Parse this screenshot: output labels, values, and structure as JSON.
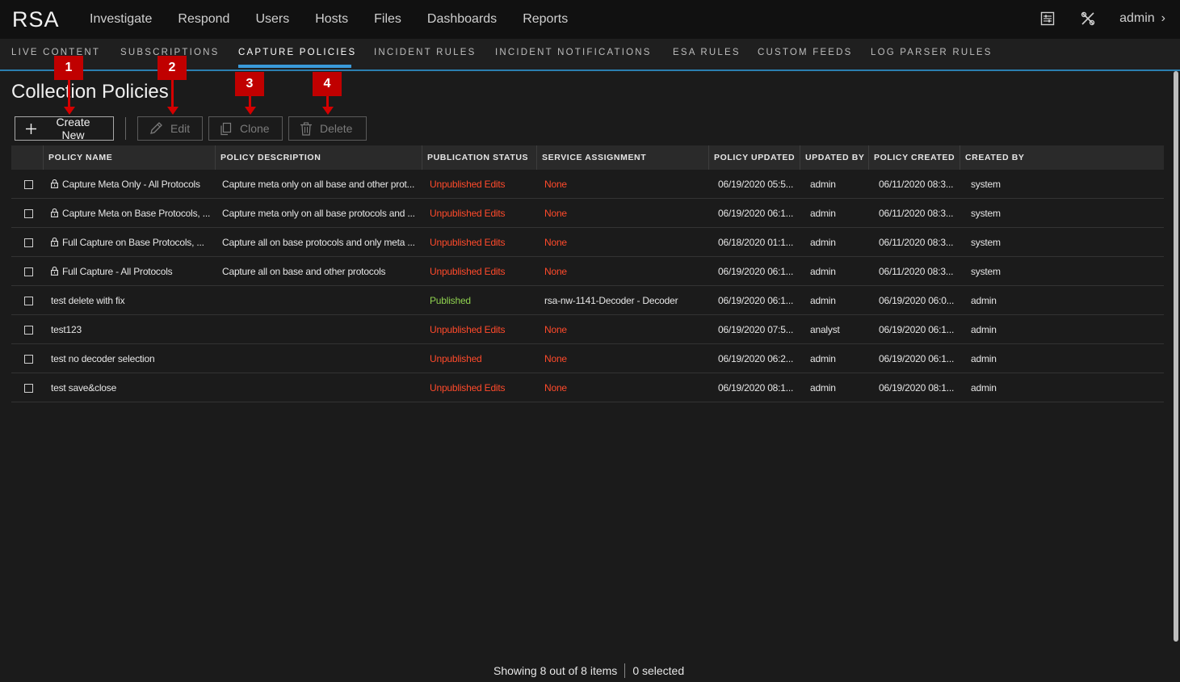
{
  "app": {
    "logo": "RSA"
  },
  "main_nav": [
    "Investigate",
    "Respond",
    "Users",
    "Hosts",
    "Files",
    "Dashboards",
    "Reports"
  ],
  "top_right": {
    "user": "admin"
  },
  "sub_tabs": [
    "LIVE CONTENT",
    "SUBSCRIPTIONS",
    "CAPTURE POLICIES",
    "INCIDENT RULES",
    "INCIDENT NOTIFICATIONS",
    "ESA RULES",
    "CUSTOM FEEDS",
    "LOG PARSER RULES"
  ],
  "active_sub_tab": "CAPTURE POLICIES",
  "page_title": "Collection Policies",
  "toolbar": {
    "create": "Create New",
    "edit": "Edit",
    "clone": "Clone",
    "delete": "Delete"
  },
  "annotations": [
    "1",
    "2",
    "3",
    "4"
  ],
  "columns": [
    "POLICY NAME",
    "POLICY DESCRIPTION",
    "PUBLICATION STATUS",
    "SERVICE ASSIGNMENT",
    "POLICY UPDATED",
    "UPDATED BY",
    "POLICY CREATED",
    "CREATED BY"
  ],
  "rows": [
    {
      "locked": true,
      "name": "Capture Meta Only - All Protocols",
      "description": "Capture meta only on all base and other prot...",
      "status": "Unpublished Edits",
      "service": "None",
      "updated": "06/19/2020 05:5...",
      "updated_by": "admin",
      "created": "06/11/2020 08:3...",
      "created_by": "system"
    },
    {
      "locked": true,
      "name": "Capture Meta on Base Protocols, ...",
      "description": "Capture meta only on all base protocols and ...",
      "status": "Unpublished Edits",
      "service": "None",
      "updated": "06/19/2020 06:1...",
      "updated_by": "admin",
      "created": "06/11/2020 08:3...",
      "created_by": "system"
    },
    {
      "locked": true,
      "name": "Full Capture on Base Protocols, ...",
      "description": "Capture all on base protocols and only meta ...",
      "status": "Unpublished Edits",
      "service": "None",
      "updated": "06/18/2020 01:1...",
      "updated_by": "admin",
      "created": "06/11/2020 08:3...",
      "created_by": "system"
    },
    {
      "locked": true,
      "name": "Full Capture - All Protocols",
      "description": "Capture all on base and other protocols",
      "status": "Unpublished Edits",
      "service": "None",
      "updated": "06/19/2020 06:1...",
      "updated_by": "admin",
      "created": "06/11/2020 08:3...",
      "created_by": "system"
    },
    {
      "locked": false,
      "name": "test delete with fix",
      "description": "",
      "status": "Published",
      "service": "rsa-nw-1141-Decoder - Decoder",
      "updated": "06/19/2020 06:1...",
      "updated_by": "admin",
      "created": "06/19/2020 06:0...",
      "created_by": "admin"
    },
    {
      "locked": false,
      "name": "test123",
      "description": "",
      "status": "Unpublished Edits",
      "service": "None",
      "updated": "06/19/2020 07:5...",
      "updated_by": "analyst",
      "created": "06/19/2020 06:1...",
      "created_by": "admin"
    },
    {
      "locked": false,
      "name": "test no decoder selection",
      "description": "",
      "status": "Unpublished",
      "service": "None",
      "updated": "06/19/2020 06:2...",
      "updated_by": "admin",
      "created": "06/19/2020 06:1...",
      "created_by": "admin"
    },
    {
      "locked": false,
      "name": "test save&close",
      "description": "",
      "status": "Unpublished Edits",
      "service": "None",
      "updated": "06/19/2020 08:1...",
      "updated_by": "admin",
      "created": "06/19/2020 08:1...",
      "created_by": "admin"
    }
  ],
  "footer": {
    "showing": "Showing 8 out of 8 items",
    "selected": "0 selected"
  },
  "colors": {
    "accent": "#3a9ad9",
    "warning": "#ff4a2b",
    "success": "#8fd14f",
    "annotation": "#c00000"
  }
}
